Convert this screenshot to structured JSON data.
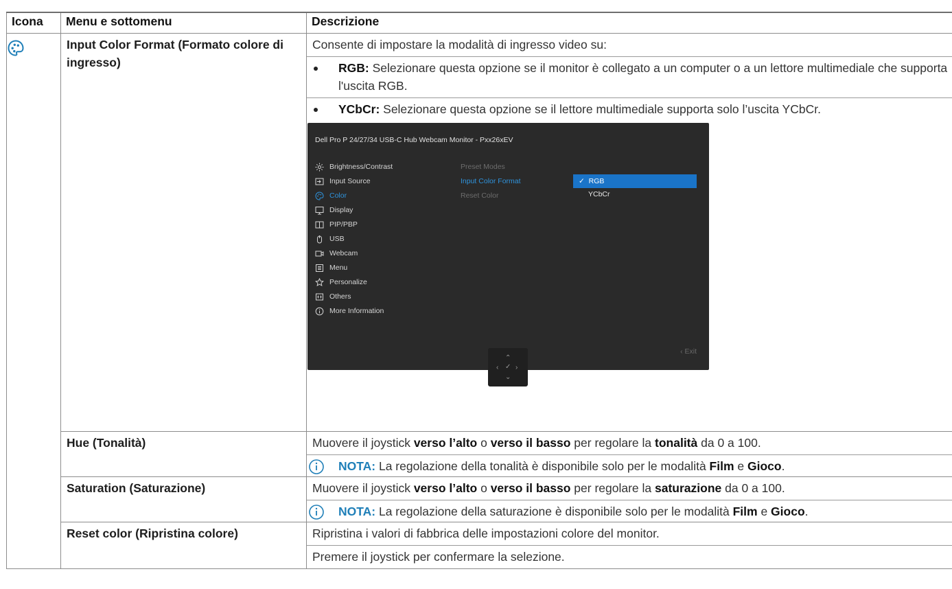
{
  "table": {
    "headers": {
      "icon": "Icona",
      "menu": "Menu e sottomenu",
      "desc": "Descrizione"
    }
  },
  "rows": {
    "input_color": {
      "menu": "Input Color Format (Formato colore di ingresso)",
      "intro": "Consente di impostare la modalità di ingresso video su:",
      "bullets": [
        {
          "label": "RGB:",
          "text": " Selezionare questa opzione se il monitor è collegato a un computer o a un lettore multimediale che supporta l'uscita RGB."
        },
        {
          "label": "YCbCr:",
          "text": " Selezionare questa opzione se il lettore multimediale supporta solo l’uscita YCbCr."
        }
      ]
    },
    "hue": {
      "menu": "Hue (Tonalità)",
      "d1": "Muovere il joystick ",
      "b1": "verso l’alto",
      "d2": " o ",
      "b2": "verso il basso",
      "d3": " per regolare la ",
      "b3": "tonalità",
      "d4": " da 0 a 100.",
      "note_label": "NOTA:",
      "note_text": " La regolazione della tonalità è disponibile solo per le modalità ",
      "note_b1": "Film",
      "note_and": " e ",
      "note_b2": "Gioco",
      "note_end": "."
    },
    "saturation": {
      "menu": "Saturation (Saturazione)",
      "d1": "Muovere il joystick ",
      "b1": "verso l’alto",
      "d2": " o ",
      "b2": "verso il basso",
      "d3": " per regolare la ",
      "b3": "saturazione",
      "d4": " da 0 a 100.",
      "note_label": "NOTA:",
      "note_text": " La regolazione della saturazione è disponibile solo per le modalità ",
      "note_b1": "Film",
      "note_and": " e ",
      "note_b2": "Gioco",
      "note_end": "."
    },
    "reset": {
      "menu": "Reset color (Ripristina colore)",
      "line1": "Ripristina i valori di fabbrica delle impostazioni colore del monitor.",
      "line2": "Premere il joystick per confermare la selezione."
    }
  },
  "osd": {
    "title": "Dell Pro P 24/27/34 USB-C Hub Webcam Monitor - Pxx26xEV",
    "menu_items": [
      {
        "label": "Brightness/Contrast",
        "icon": "sun-icon"
      },
      {
        "label": "Input Source",
        "icon": "input-icon"
      },
      {
        "label": "Color",
        "icon": "palette-icon",
        "active": true
      },
      {
        "label": "Display",
        "icon": "display-icon"
      },
      {
        "label": "PIP/PBP",
        "icon": "pip-icon"
      },
      {
        "label": "USB",
        "icon": "usb-icon"
      },
      {
        "label": "Webcam",
        "icon": "webcam-icon"
      },
      {
        "label": "Menu",
        "icon": "menu-icon"
      },
      {
        "label": "Personalize",
        "icon": "star-icon"
      },
      {
        "label": "Others",
        "icon": "others-icon"
      },
      {
        "label": "More Information",
        "icon": "info-icon"
      }
    ],
    "submenu": [
      {
        "label": "Preset Modes"
      },
      {
        "label": "Input Color Format",
        "active": true
      },
      {
        "label": "Reset Color"
      }
    ],
    "options": [
      {
        "label": "RGB",
        "selected": true
      },
      {
        "label": "YCbCr"
      }
    ],
    "exit": "Exit",
    "accent_color": "#1a74c8"
  }
}
